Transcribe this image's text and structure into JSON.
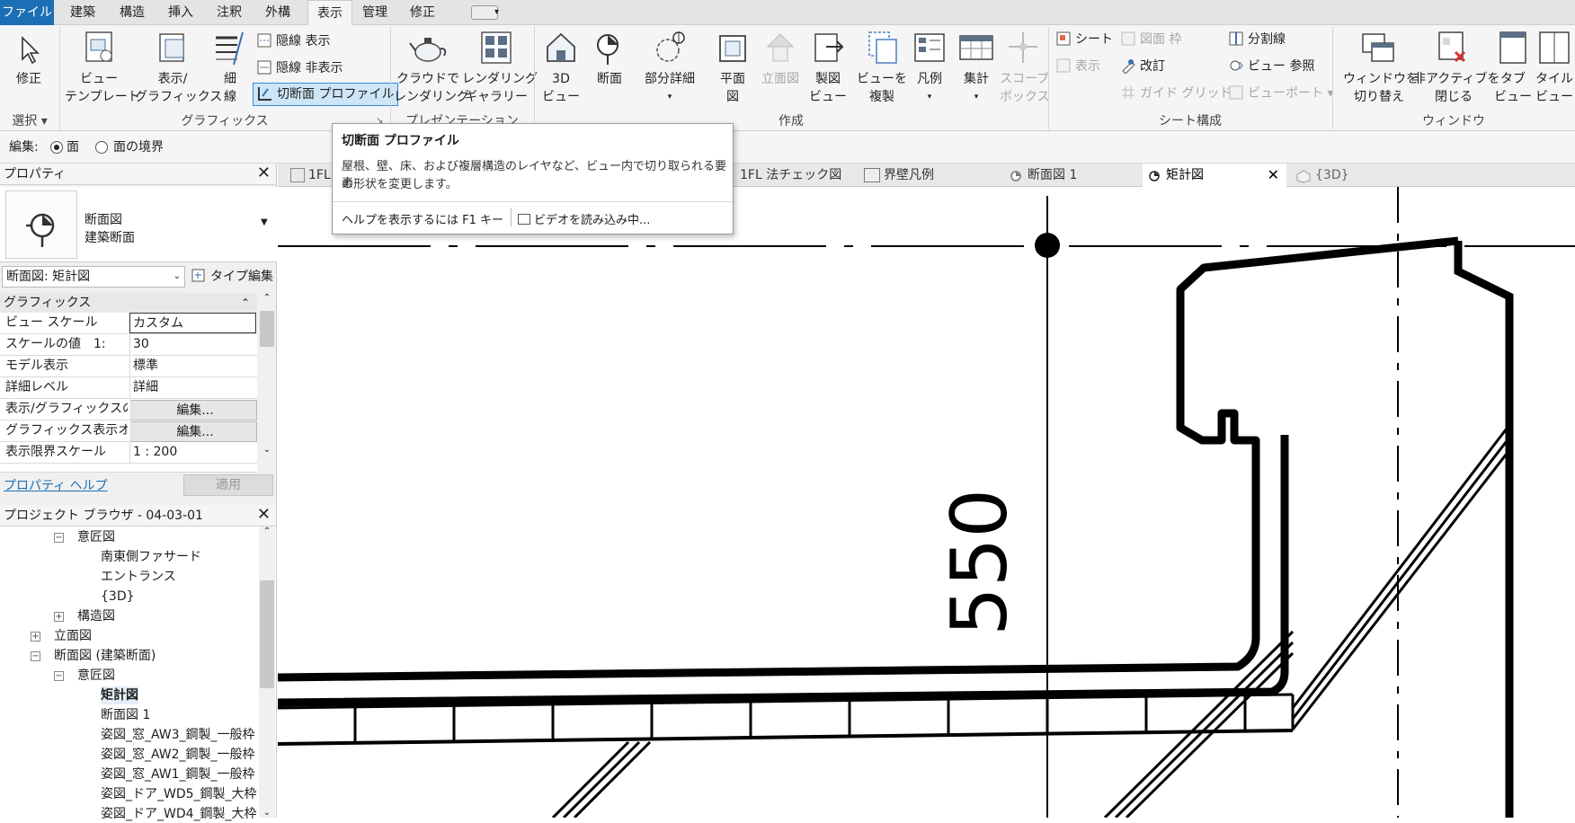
{
  "menu_tabs": [
    "ファイル",
    "建築",
    "構造",
    "挿入",
    "注釈",
    "外構",
    "表示",
    "管理",
    "修正"
  ],
  "ribbon": {
    "modify": "修正",
    "view_template": [
      "ビュー",
      "テンプレート"
    ],
    "visibility_graphics": [
      "表示/",
      "グラフィックス"
    ],
    "thin_lines": [
      "細",
      "線"
    ],
    "show_hidden": "隠線 表示",
    "remove_hidden": "隠線 非表示",
    "cut_profile": "切断面 プロファイル",
    "cloud_render": [
      "クラウドで",
      "レンダリング"
    ],
    "render_gallery": [
      "レンダリング",
      "ギャラリー"
    ],
    "view_3d": [
      "3D",
      "ビュー"
    ],
    "section": "断面",
    "callout": "部分詳細",
    "plan": [
      "平面",
      "図"
    ],
    "elevation": "立面図",
    "drafting": [
      "製図",
      "ビュー"
    ],
    "duplicate": [
      "ビューを",
      "複製"
    ],
    "legend": "凡例",
    "schedules": "集計",
    "scope_box": [
      "スコープ",
      "ボックス"
    ],
    "sheet": "シート",
    "title_block": "図面 枠",
    "view": "表示",
    "revisions": "改訂",
    "guide_grid": "ガイド グリッド",
    "matchline": "分割線",
    "view_reference": "ビュー 参照",
    "viewports": "ビューポート",
    "switch_windows": [
      "ウィンドウを",
      "切り替え"
    ],
    "close_inactive": [
      "非アクティブを",
      "閉じる"
    ],
    "tab_views": [
      "タブ",
      "ビュー"
    ],
    "tile_views": [
      "タイル",
      "ビュー"
    ],
    "panels": {
      "select": "選択",
      "graphics": "グラフィックス",
      "presentation": "プレゼンテーション",
      "create": "作成",
      "sheet_comp": "シート構成",
      "windows": "ウィンドウ"
    }
  },
  "options_bar": {
    "label": "編集:",
    "opt1": "面",
    "opt2": "面の境界"
  },
  "tooltip": {
    "title": "切断面 プロファイル",
    "body1": "屋根、壁、床、および複層構造のレイヤなど、ビュー内で切り取られる要素",
    "body2": "の形状を変更します。",
    "help": "ヘルプを表示するには F1 キー",
    "video": "ビデオを読み込み中..."
  },
  "properties": {
    "title": "プロパティ",
    "type_name1": "断面図",
    "type_name2": "建築断面",
    "selector": "断面図: 矩計図",
    "edit_type": "タイプ編集",
    "group": "グラフィックス",
    "rows": [
      {
        "k": "ビュー スケール",
        "v": "カスタム"
      },
      {
        "k": "スケールの値　1:",
        "v": "30"
      },
      {
        "k": "モデル表示",
        "v": "標準"
      },
      {
        "k": "詳細レベル",
        "v": "詳細"
      },
      {
        "k": "表示/グラフィックスの...",
        "v": "編集..."
      },
      {
        "k": "グラフィックス表示オ...",
        "v": "編集..."
      },
      {
        "k": "表示限界スケール",
        "v": "1 : 200"
      }
    ],
    "help": "プロパティ ヘルプ",
    "apply": "適用"
  },
  "browser": {
    "title": "プロジェクト ブラウザ - 04-03-01",
    "items": [
      "意匠図",
      "南東側ファサード",
      "エントランス",
      "{3D}",
      "構造図",
      "立面図",
      "断面図 (建築断面)",
      "意匠図",
      "矩計図",
      "断面図 1",
      "姿図_窓_AW3_鋼製_一般枠",
      "姿図_窓_AW2_鋼製_一般枠",
      "姿図_窓_AW1_鋼製_一般枠",
      "姿図_ドア_WD5_鋼製_大枠",
      "姿図_ドア_WD4_鋼製_大枠"
    ]
  },
  "view_tabs": [
    "1FL",
    "1FL 法チェック図",
    "界壁凡例",
    "断面図 1",
    "矩計図",
    "{3D}"
  ],
  "drawing": {
    "dimension": "550"
  },
  "colors": {
    "file_tab": "#1d6fb5",
    "highlight": "#cde6f7"
  }
}
